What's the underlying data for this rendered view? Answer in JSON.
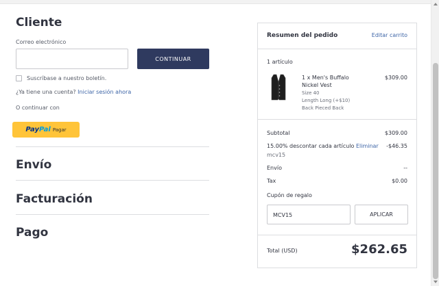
{
  "customer": {
    "heading": "Cliente",
    "email_label": "Correo electrónico",
    "email_value": "",
    "continue_label": "CONTINUAR",
    "newsletter_label": "Suscríbase a nuestro boletín.",
    "account_question": "¿Ya tiene una cuenta?",
    "login_link": "Iniciar sesión ahora",
    "or_continue": "O continuar con",
    "paypal": {
      "pay": "Pay",
      "pal": "Pal",
      "label": "Pagar"
    }
  },
  "sections": {
    "shipping": "Envío",
    "billing": "Facturación",
    "payment": "Pago"
  },
  "summary": {
    "title": "Resumen del pedido",
    "edit_cart": "Editar carrito",
    "items_count": "1 artículo",
    "item": {
      "title": "1 x Men's Buffalo Nickel Vest",
      "size": "Size 40",
      "length": "Length Long (+$10)",
      "back": "Back Pieced Back",
      "price": "$309.00"
    },
    "subtotal_label": "Subtotal",
    "subtotal_value": "$309.00",
    "discount_label": "15.00% descontar cada artículo",
    "discount_remove": "Eliminar",
    "discount_value": "-$46.35",
    "discount_code": "mcv15",
    "shipping_label": "Envío",
    "shipping_value": "--",
    "tax_label": "Tax",
    "tax_value": "$0.00",
    "coupon_label": "Cupón de regalo",
    "coupon_value": "MCV15",
    "apply_label": "APLICAR",
    "total_label": "Total (USD)",
    "total_value": "$262.65"
  },
  "colors": {
    "primary_button": "#2f3a5f",
    "link": "#3c64a6",
    "paypal_yellow": "#ffc439"
  }
}
